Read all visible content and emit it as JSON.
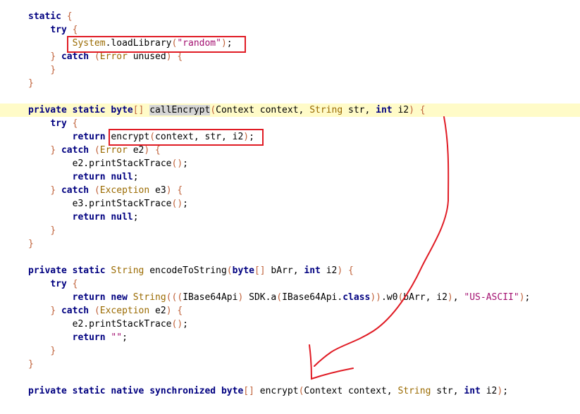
{
  "lines": [
    {
      "tokens": [
        {
          "t": "static",
          "c": "kw"
        },
        {
          "t": " "
        },
        {
          "t": "{",
          "c": "pn"
        }
      ]
    },
    {
      "tokens": [
        {
          "t": "    "
        },
        {
          "t": "try",
          "c": "kw"
        },
        {
          "t": " "
        },
        {
          "t": "{",
          "c": "pn"
        }
      ]
    },
    {
      "tokens": [
        {
          "t": "        "
        },
        {
          "t": "System",
          "c": "ty"
        },
        {
          "t": ".loadLibrary"
        },
        {
          "t": "(",
          "c": "pn"
        },
        {
          "t": "\"random\"",
          "c": "str"
        },
        {
          "t": ")",
          "c": "pn"
        },
        {
          "t": ";"
        }
      ]
    },
    {
      "tokens": [
        {
          "t": "    "
        },
        {
          "t": "}",
          "c": "pn"
        },
        {
          "t": " "
        },
        {
          "t": "catch",
          "c": "kw"
        },
        {
          "t": " "
        },
        {
          "t": "(",
          "c": "pn"
        },
        {
          "t": "Error",
          "c": "ty"
        },
        {
          "t": " unused"
        },
        {
          "t": ")",
          "c": "pn"
        },
        {
          "t": " "
        },
        {
          "t": "{",
          "c": "pn"
        }
      ]
    },
    {
      "tokens": [
        {
          "t": "    "
        },
        {
          "t": "}",
          "c": "pn"
        }
      ]
    },
    {
      "tokens": [
        {
          "t": "}",
          "c": "pn"
        }
      ]
    },
    {
      "tokens": []
    },
    {
      "highlight": true,
      "tokens": [
        {
          "t": "private",
          "c": "kw"
        },
        {
          "t": " "
        },
        {
          "t": "static",
          "c": "kw"
        },
        {
          "t": " "
        },
        {
          "t": "byte",
          "c": "kw"
        },
        {
          "t": "[]",
          "c": "pn"
        },
        {
          "t": " "
        },
        {
          "t": "callEncrypt",
          "c": "sel"
        },
        {
          "t": "(",
          "c": "pn"
        },
        {
          "t": "Context context, "
        },
        {
          "t": "String",
          "c": "ty"
        },
        {
          "t": " str, "
        },
        {
          "t": "int",
          "c": "kw"
        },
        {
          "t": " i2"
        },
        {
          "t": ")",
          "c": "pn"
        },
        {
          "t": " "
        },
        {
          "t": "{",
          "c": "pn"
        }
      ]
    },
    {
      "tokens": [
        {
          "t": "    "
        },
        {
          "t": "try",
          "c": "kw"
        },
        {
          "t": " "
        },
        {
          "t": "{",
          "c": "pn"
        }
      ]
    },
    {
      "tokens": [
        {
          "t": "        "
        },
        {
          "t": "return",
          "c": "kw"
        },
        {
          "t": " encrypt"
        },
        {
          "t": "(",
          "c": "pn"
        },
        {
          "t": "context, str, i2"
        },
        {
          "t": ")",
          "c": "pn"
        },
        {
          "t": ";"
        }
      ]
    },
    {
      "tokens": [
        {
          "t": "    "
        },
        {
          "t": "}",
          "c": "pn"
        },
        {
          "t": " "
        },
        {
          "t": "catch",
          "c": "kw"
        },
        {
          "t": " "
        },
        {
          "t": "(",
          "c": "pn"
        },
        {
          "t": "Error",
          "c": "ty"
        },
        {
          "t": " e2"
        },
        {
          "t": ")",
          "c": "pn"
        },
        {
          "t": " "
        },
        {
          "t": "{",
          "c": "pn"
        }
      ]
    },
    {
      "tokens": [
        {
          "t": "        "
        },
        {
          "t": "e2.printStackTrace"
        },
        {
          "t": "()",
          "c": "pn"
        },
        {
          "t": ";"
        }
      ]
    },
    {
      "tokens": [
        {
          "t": "        "
        },
        {
          "t": "return",
          "c": "kw"
        },
        {
          "t": " "
        },
        {
          "t": "null",
          "c": "kw"
        },
        {
          "t": ";"
        }
      ]
    },
    {
      "tokens": [
        {
          "t": "    "
        },
        {
          "t": "}",
          "c": "pn"
        },
        {
          "t": " "
        },
        {
          "t": "catch",
          "c": "kw"
        },
        {
          "t": " "
        },
        {
          "t": "(",
          "c": "pn"
        },
        {
          "t": "Exception",
          "c": "ty"
        },
        {
          "t": " e3"
        },
        {
          "t": ")",
          "c": "pn"
        },
        {
          "t": " "
        },
        {
          "t": "{",
          "c": "pn"
        }
      ]
    },
    {
      "tokens": [
        {
          "t": "        "
        },
        {
          "t": "e3.printStackTrace"
        },
        {
          "t": "()",
          "c": "pn"
        },
        {
          "t": ";"
        }
      ]
    },
    {
      "tokens": [
        {
          "t": "        "
        },
        {
          "t": "return",
          "c": "kw"
        },
        {
          "t": " "
        },
        {
          "t": "null",
          "c": "kw"
        },
        {
          "t": ";"
        }
      ]
    },
    {
      "tokens": [
        {
          "t": "    "
        },
        {
          "t": "}",
          "c": "pn"
        }
      ]
    },
    {
      "tokens": [
        {
          "t": "}",
          "c": "pn"
        }
      ]
    },
    {
      "tokens": []
    },
    {
      "tokens": [
        {
          "t": "private",
          "c": "kw"
        },
        {
          "t": " "
        },
        {
          "t": "static",
          "c": "kw"
        },
        {
          "t": " "
        },
        {
          "t": "String",
          "c": "ty"
        },
        {
          "t": " encodeToString"
        },
        {
          "t": "(",
          "c": "pn"
        },
        {
          "t": "byte",
          "c": "kw"
        },
        {
          "t": "[]",
          "c": "pn"
        },
        {
          "t": " bArr, "
        },
        {
          "t": "int",
          "c": "kw"
        },
        {
          "t": " i2"
        },
        {
          "t": ")",
          "c": "pn"
        },
        {
          "t": " "
        },
        {
          "t": "{",
          "c": "pn"
        }
      ]
    },
    {
      "tokens": [
        {
          "t": "    "
        },
        {
          "t": "try",
          "c": "kw"
        },
        {
          "t": " "
        },
        {
          "t": "{",
          "c": "pn"
        }
      ]
    },
    {
      "tokens": [
        {
          "t": "        "
        },
        {
          "t": "return",
          "c": "kw"
        },
        {
          "t": " "
        },
        {
          "t": "new",
          "c": "kw"
        },
        {
          "t": " "
        },
        {
          "t": "String",
          "c": "ty"
        },
        {
          "t": "(((",
          "c": "pn"
        },
        {
          "t": "IBase64Api"
        },
        {
          "t": ")",
          "c": "pn"
        },
        {
          "t": " SDK.a"
        },
        {
          "t": "(",
          "c": "pn"
        },
        {
          "t": "IBase64Api."
        },
        {
          "t": "class",
          "c": "kw"
        },
        {
          "t": "))",
          "c": "pn"
        },
        {
          "t": ".w0"
        },
        {
          "t": "(",
          "c": "pn"
        },
        {
          "t": "bArr, i2"
        },
        {
          "t": ")",
          "c": "pn"
        },
        {
          "t": ", "
        },
        {
          "t": "\"US-ASCII\"",
          "c": "str"
        },
        {
          "t": ")",
          "c": "pn"
        },
        {
          "t": ";"
        }
      ]
    },
    {
      "tokens": [
        {
          "t": "    "
        },
        {
          "t": "}",
          "c": "pn"
        },
        {
          "t": " "
        },
        {
          "t": "catch",
          "c": "kw"
        },
        {
          "t": " "
        },
        {
          "t": "(",
          "c": "pn"
        },
        {
          "t": "Exception",
          "c": "ty"
        },
        {
          "t": " e2"
        },
        {
          "t": ")",
          "c": "pn"
        },
        {
          "t": " "
        },
        {
          "t": "{",
          "c": "pn"
        }
      ]
    },
    {
      "tokens": [
        {
          "t": "        "
        },
        {
          "t": "e2.printStackTrace"
        },
        {
          "t": "()",
          "c": "pn"
        },
        {
          "t": ";"
        }
      ]
    },
    {
      "tokens": [
        {
          "t": "        "
        },
        {
          "t": "return",
          "c": "kw"
        },
        {
          "t": " "
        },
        {
          "t": "\"\"",
          "c": "str"
        },
        {
          "t": ";"
        }
      ]
    },
    {
      "tokens": [
        {
          "t": "    "
        },
        {
          "t": "}",
          "c": "pn"
        }
      ]
    },
    {
      "tokens": [
        {
          "t": "}",
          "c": "pn"
        }
      ]
    },
    {
      "tokens": []
    },
    {
      "tokens": [
        {
          "t": "private",
          "c": "kw"
        },
        {
          "t": " "
        },
        {
          "t": "static",
          "c": "kw"
        },
        {
          "t": " "
        },
        {
          "t": "native",
          "c": "kw"
        },
        {
          "t": " "
        },
        {
          "t": "synchronized",
          "c": "kw"
        },
        {
          "t": " "
        },
        {
          "t": "byte",
          "c": "kw"
        },
        {
          "t": "[]",
          "c": "pn"
        },
        {
          "t": " encrypt"
        },
        {
          "t": "(",
          "c": "pn"
        },
        {
          "t": "Context context, "
        },
        {
          "t": "String",
          "c": "ty"
        },
        {
          "t": " str, "
        },
        {
          "t": "int",
          "c": "kw"
        },
        {
          "t": " i2"
        },
        {
          "t": ")",
          "c": "pn"
        },
        {
          "t": ";"
        }
      ]
    }
  ],
  "colors": {
    "keyword": "#000080",
    "type": "#9a6a00",
    "string": "#a31070",
    "paren": "#c0623a",
    "line_highlight": "#fffbc8",
    "selection": "#d6d6d6",
    "annotation": "#e01b24"
  }
}
